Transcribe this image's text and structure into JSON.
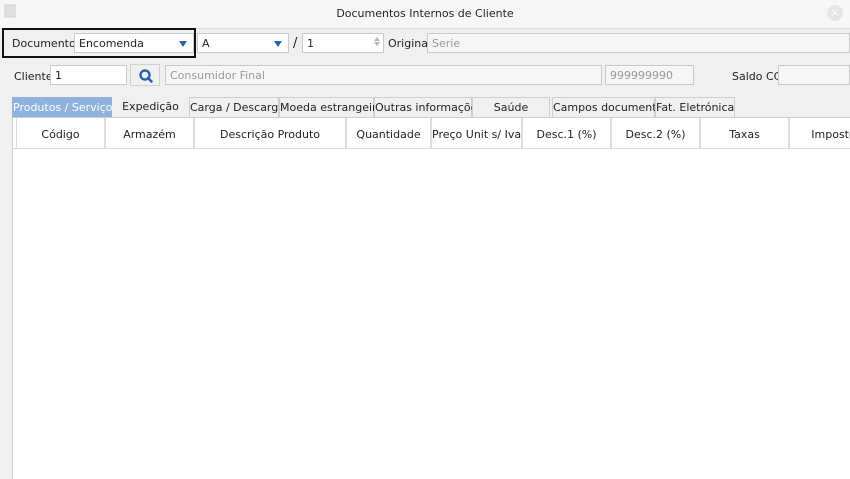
{
  "window": {
    "title": "Documentos Internos de Cliente"
  },
  "header": {
    "documento_label": "Documento",
    "documento_value": "Encomenda",
    "serie_value": "A",
    "slash": "/",
    "numero_value": "1",
    "original_label": "Original",
    "serie_placeholder": "Serie"
  },
  "client": {
    "label": "Cliente",
    "number": "1",
    "name": "Consumidor Final",
    "nif": "999999990",
    "saldo_label": "Saldo CC",
    "saldo_value": ""
  },
  "tabs": [
    {
      "label": "Produtos / Serviços",
      "active": true
    },
    {
      "label": "Expedição"
    },
    {
      "label": "Carga / Descarga"
    },
    {
      "label": "Moeda estrangeira"
    },
    {
      "label": "Outras informações"
    },
    {
      "label": "Saúde"
    },
    {
      "label": "Campos documento"
    },
    {
      "label": "Fat. Eletrónica"
    }
  ],
  "grid": {
    "columns": [
      "Código",
      "Armazém",
      "Descrição Produto",
      "Quantidade",
      "Preço Unit s/ Iva",
      "Desc.1 (%)",
      "Desc.2 (%)",
      "Taxas",
      "Imposto"
    ],
    "rows": []
  },
  "colors": {
    "accent": "#2a62a8",
    "active_tab": "#8fb3de"
  }
}
